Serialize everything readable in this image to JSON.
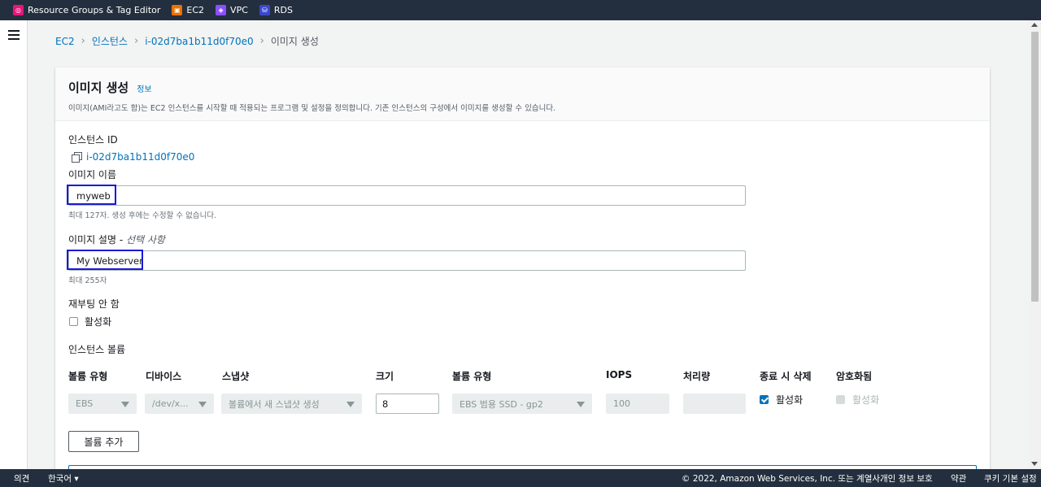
{
  "topnav": {
    "favorites": [
      {
        "label": "Resource Groups & Tag Editor",
        "icon": "resource-groups-icon",
        "color": "#e7157b"
      },
      {
        "label": "EC2",
        "icon": "ec2-icon",
        "color": "#ed7100"
      },
      {
        "label": "VPC",
        "icon": "vpc-icon",
        "color": "#8c4fff"
      },
      {
        "label": "RDS",
        "icon": "rds-icon",
        "color": "#3b48cc"
      }
    ]
  },
  "breadcrumb": {
    "items": [
      "EC2",
      "인스턴스",
      "i-02d7ba1b11d0f70e0"
    ],
    "current": "이미지 생성"
  },
  "panel": {
    "title": "이미지 생성",
    "info": "정보",
    "description": "이미지(AMI라고도 함)는 EC2 인스턴스를 시작할 때 적용되는 프로그램 및 설정을 정의합니다. 기존 인스턴스의 구성에서 이미지를 생성할 수 있습니다."
  },
  "instance_id": {
    "label": "인스턴스 ID",
    "value": "i-02d7ba1b11d0f70e0"
  },
  "image_name": {
    "label": "이미지 이름",
    "value": "myweb",
    "hint": "최대 127자. 생성 후에는 수정할 수 없습니다."
  },
  "image_description": {
    "label": "이미지 설명 - ",
    "optional": "선택 사항",
    "value": "My Webserver",
    "hint": "최대 255자"
  },
  "no_reboot": {
    "label": "재부팅 안 함",
    "checkbox_label": "활성화",
    "checked": false
  },
  "volumes": {
    "label": "인스턴스 볼륨",
    "columns": [
      "볼륨 유형",
      "디바이스",
      "스냅샷",
      "크기",
      "볼륨 유형",
      "IOPS",
      "처리량",
      "종료 시 삭제",
      "암호화됨"
    ],
    "row": {
      "volume_type": "EBS",
      "device": "/dev/x...",
      "snapshot": "볼륨에서 새 스냅샷 생성",
      "size": "8",
      "ebs_type": "EBS 범용 SSD - gp2",
      "iops": "100",
      "throughput": "",
      "delete_on_termination": "활성화",
      "delete_checked": true,
      "encrypted": "활성화",
      "encrypted_checked": false
    },
    "add_button": "볼륨 추가"
  },
  "footer": {
    "feedback": "의견",
    "language": "한국어",
    "copyright": "© 2022, Amazon Web Services, Inc. 또는 계열사.",
    "privacy": "개인 정보 보호",
    "terms": "약관",
    "cookies": "쿠키 기본 설정"
  },
  "colors": {
    "nav_bg": "#232f3e",
    "link": "#0073bb",
    "highlight": "#1a1ad6"
  }
}
